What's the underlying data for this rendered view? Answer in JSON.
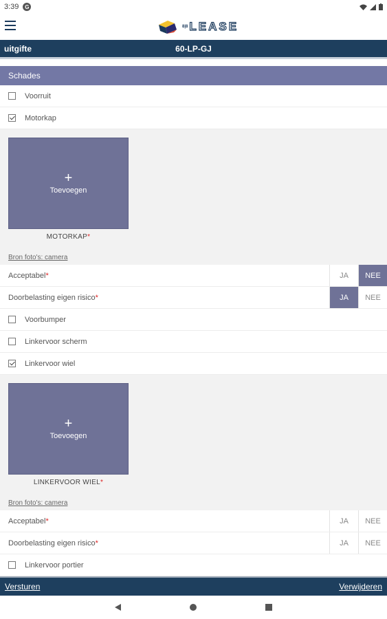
{
  "status_bar": {
    "time": "3:39",
    "g_glyph": "G",
    "icons": [
      "wifi-icon",
      "signal-icon",
      "battery-icon"
    ]
  },
  "app": {
    "logo_text": "LEASE",
    "logo_prefix": "8|8"
  },
  "title_bar": {
    "left": "uitgifte",
    "center": "60-LP-GJ"
  },
  "section": {
    "title": "Schades"
  },
  "items": {
    "voorruit": "Voorruit",
    "motorkap": "Motorkap",
    "voorbumper": "Voorbumper",
    "linkervoor_scherm": "Linkervoor scherm",
    "linkervoor_wiel": "Linkervoor wiel",
    "linkervoor_portier": "Linkervoor portier"
  },
  "photo1": {
    "plus": "+",
    "add_label": "Toevoegen",
    "caption": "MOTORKAP",
    "req": "*",
    "source": "Bron foto's: camera"
  },
  "photo2": {
    "plus": "+",
    "add_label": "Toevoegen",
    "caption": "LINKERVOOR WIEL",
    "req": "*",
    "source": "Bron foto's: camera"
  },
  "questions": {
    "acceptabel": "Acceptabel",
    "doorbelasting": "Doorbelasting eigen risico",
    "req": "*",
    "ja": "JA",
    "nee": "NEE"
  },
  "bottom_bar": {
    "send": "Versturen",
    "delete": "Verwijderen"
  },
  "colors": {
    "primary": "#1e3f5e",
    "accent": "#6f7297",
    "section": "#7378a5"
  }
}
